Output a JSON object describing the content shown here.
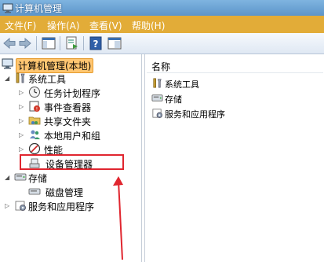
{
  "window": {
    "title": "计算机管理"
  },
  "menu": [
    "文件(F)",
    "操作(A)",
    "查看(V)",
    "帮助(H)"
  ],
  "toolbar": {
    "icons": [
      "back-arrow-icon",
      "forward-arrow-icon",
      "show-hide-tree-icon",
      "export-list-icon",
      "help-icon",
      "console-icon"
    ]
  },
  "tree": {
    "root": "计算机管理(本地)",
    "system_tools": "系统工具",
    "task_scheduler": "任务计划程序",
    "event_viewer": "事件查看器",
    "shared_folders": "共享文件夹",
    "local_users": "本地用户和组",
    "performance": "性能",
    "device_manager": "设备管理器",
    "storage": "存储",
    "disk_management": "磁盘管理",
    "services": "服务和应用程序"
  },
  "list": {
    "column_name": "名称",
    "items": [
      "系统工具",
      "存储",
      "服务和应用程序"
    ]
  },
  "colors": {
    "menubar": "#e2ac38",
    "highlight": "#ffc671",
    "annotation": "#e0262f"
  }
}
